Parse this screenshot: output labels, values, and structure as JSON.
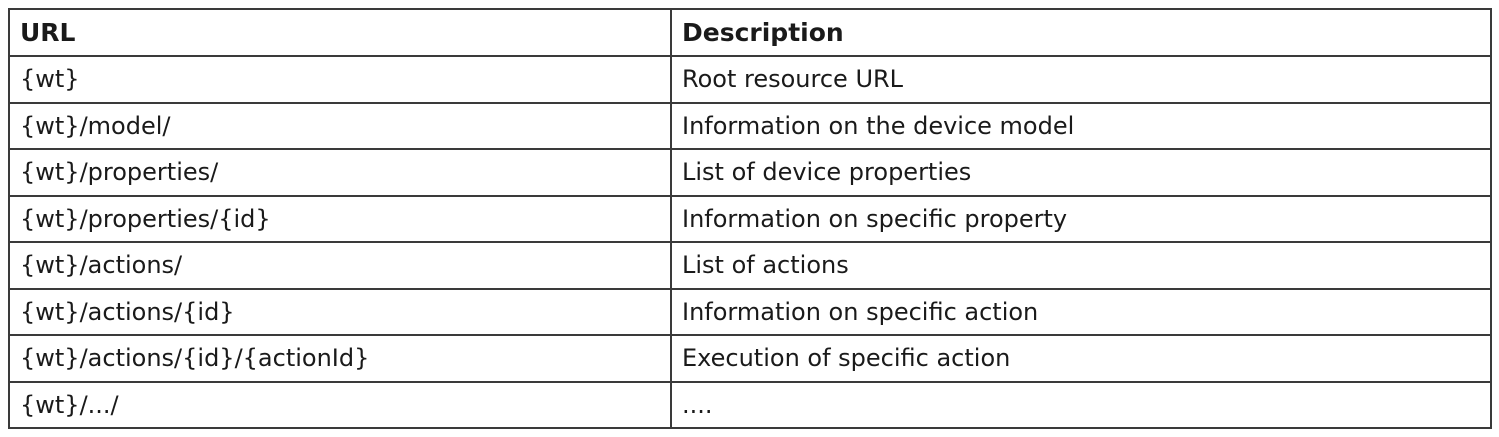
{
  "table": {
    "headers": [
      "URL",
      "Description"
    ],
    "rows": [
      {
        "url": "{wt}",
        "description": "Root resource URL"
      },
      {
        "url": "{wt}/model/",
        "description": "Information on the device model"
      },
      {
        "url": "{wt}/properties/",
        "description": "List of device properties"
      },
      {
        "url": "{wt}/properties/{id}",
        "description": "Information on specific property"
      },
      {
        "url": "{wt}/actions/",
        "description": "List of actions"
      },
      {
        "url": "{wt}/actions/{id}",
        "description": "Information on specific action"
      },
      {
        "url": "{wt}/actions/{id}/{actionId}",
        "description": "Execution of specific action"
      },
      {
        "url": "{wt}/.../",
        "description": "...."
      }
    ]
  }
}
